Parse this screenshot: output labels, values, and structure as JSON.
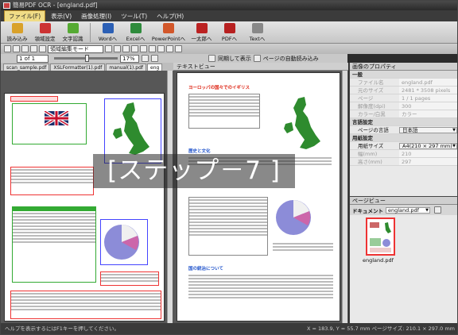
{
  "window": {
    "title": "簡易PDF OCR - [england.pdf]"
  },
  "menu": {
    "items": [
      "ファイル(F)",
      "表示(V)",
      "画像処理(I)",
      "ツール(T)",
      "ヘルプ(H)"
    ]
  },
  "ribbon": {
    "buttons": [
      {
        "label": "読み込み",
        "icon": "open-icon",
        "color": "#d9a12a"
      },
      {
        "label": "領域設定",
        "icon": "region-icon",
        "color": "#c33"
      },
      {
        "label": "文字認識",
        "icon": "ocr-icon",
        "color": "#5a3"
      },
      {
        "label": "Wordへ",
        "icon": "word-icon",
        "color": "#2b5fb5"
      },
      {
        "label": "Excelへ",
        "icon": "excel-icon",
        "color": "#2e8b3c"
      },
      {
        "label": "PowerPointへ",
        "icon": "powerpoint-icon",
        "color": "#d2572a"
      },
      {
        "label": "一太郎へ",
        "icon": "ichitaro-icon",
        "color": "#b22"
      },
      {
        "label": "PDFへ",
        "icon": "pdf-icon",
        "color": "#b72020"
      },
      {
        "label": "Textへ",
        "icon": "text-icon",
        "color": "#888"
      }
    ]
  },
  "toolbar": {
    "mode_select": "領域編集モード",
    "page_field": "1 of 1",
    "zoom": "17%",
    "sync_label": "同期して表示",
    "select_all_label": "ページの自動読み込み"
  },
  "tabs": [
    "scan_sample.pdf",
    "XSLFormatter(1).pdf",
    "manual(1).pdf",
    "eng"
  ],
  "text_view": {
    "header": "テキストビュー",
    "heading": "ヨーロッパの国々でのイギリス",
    "sub1": "歴史と文化",
    "sub2": "国の統治について"
  },
  "properties": {
    "header": "画像のプロパティ",
    "sections": [
      {
        "title": "一般",
        "rows": [
          {
            "key": "ファイル名",
            "value": "england.pdf",
            "enabled": false
          },
          {
            "key": "元のサイズ",
            "value": "2481 * 3508 pixels",
            "enabled": false
          },
          {
            "key": "ページ",
            "value": "1 / 1 pages",
            "enabled": false
          },
          {
            "key": "解像度(dpi)",
            "value": "300",
            "enabled": false
          },
          {
            "key": "カラー/白黒",
            "value": "カラー",
            "enabled": false
          }
        ]
      },
      {
        "title": "言語設定",
        "rows": [
          {
            "key": "ページの言語",
            "value": "日本語",
            "enabled": true
          }
        ]
      },
      {
        "title": "用紙設定",
        "rows": [
          {
            "key": "用紙サイズ",
            "value": "A4(210 × 297 mm)",
            "enabled": true
          },
          {
            "key": "幅(mm)",
            "value": "210",
            "enabled": false
          },
          {
            "key": "高さ(mm)",
            "value": "297",
            "enabled": false
          }
        ]
      }
    ]
  },
  "page_view": {
    "header": "ページビュー",
    "doc_label": "ドキュメント",
    "doc_value": "england.pdf",
    "thumb_caption": "england.pdf"
  },
  "overlay": {
    "step_text": "[ステップ－7 ]"
  },
  "status": {
    "left": "ヘルプを表示するにはF1キーを押してください。",
    "right": "X = 183.9, Y = 55.7 mm   ページサイズ: 210.1 × 297.0 mm"
  }
}
